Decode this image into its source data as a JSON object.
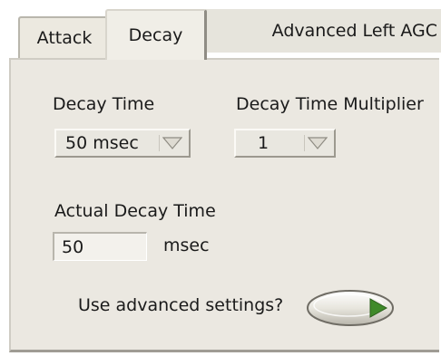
{
  "tabs": [
    {
      "label": "Attack",
      "selected": false
    },
    {
      "label": "Decay",
      "selected": true
    },
    {
      "label": "Advanced Left AGC",
      "selected": false
    }
  ],
  "decay_time": {
    "label": "Decay Time",
    "value": "50 msec"
  },
  "decay_multiplier": {
    "label": "Decay Time Multiplier",
    "value": "1"
  },
  "actual_decay": {
    "label": "Actual Decay Time",
    "value": "50",
    "unit": "msec"
  },
  "advanced": {
    "label": "Use advanced settings?",
    "state": false,
    "led_color": "#3f8a2a"
  },
  "colors": {
    "panel": "#ebe8e1",
    "tab_active": "#f0eee7",
    "indicator": "#f3f1ec"
  }
}
